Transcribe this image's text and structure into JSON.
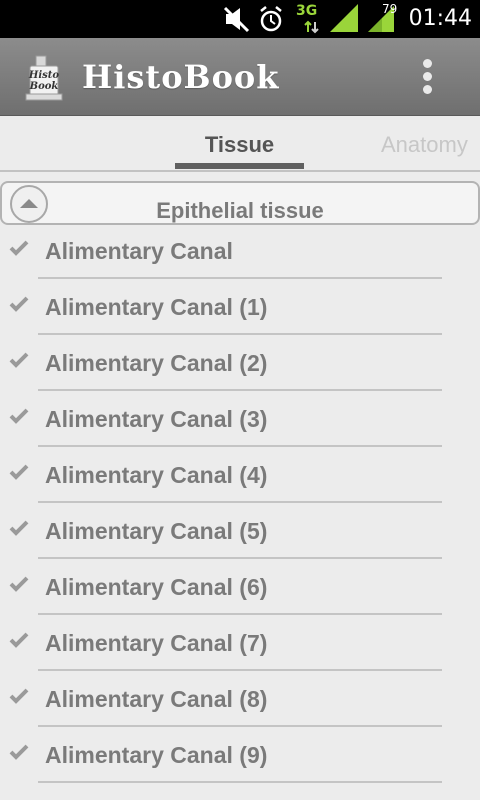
{
  "status_bar": {
    "network_type": "3G",
    "battery_level": "79",
    "time": "01:44",
    "icons": [
      "mute-icon",
      "alarm-icon",
      "data-3g-icon",
      "signal-icon",
      "battery-icon"
    ]
  },
  "action_bar": {
    "logo_text": "Histo Book",
    "title": "HistoBook",
    "overflow_icon": "overflow-menu-icon"
  },
  "tabs": [
    {
      "label": "Tissue",
      "selected": true
    },
    {
      "label": "Anatomy",
      "selected": false
    }
  ],
  "group": {
    "title": "Epithelial tissue",
    "expanded": true,
    "toggle_icon": "collapse-arrow-icon"
  },
  "items": [
    {
      "label": "Alimentary Canal"
    },
    {
      "label": "Alimentary Canal (1)"
    },
    {
      "label": "Alimentary Canal (2)"
    },
    {
      "label": "Alimentary Canal (3)"
    },
    {
      "label": "Alimentary Canal (4)"
    },
    {
      "label": "Alimentary Canal (5)"
    },
    {
      "label": "Alimentary Canal (6)"
    },
    {
      "label": "Alimentary Canal (7)"
    },
    {
      "label": "Alimentary Canal (8)"
    },
    {
      "label": "Alimentary Canal (9)"
    }
  ],
  "colors": {
    "action_bar": "#7e7e7e",
    "tab_indicator": "#606060",
    "item_text": "#7a7a7a",
    "network_accent": "#9ad53a"
  }
}
